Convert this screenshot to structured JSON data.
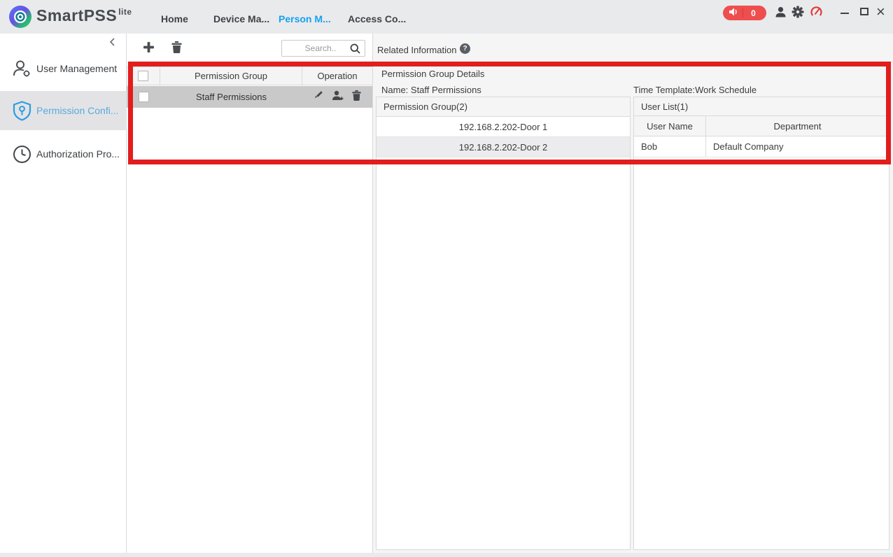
{
  "app": {
    "brand": "SmartPSS",
    "brand_suffix": "lite"
  },
  "nav": {
    "tabs": [
      "Home",
      "Device Ma...",
      "Person M...",
      "Access Co..."
    ],
    "active_tab": "Person M..."
  },
  "topbar": {
    "alarm_count": "0"
  },
  "sidebar": {
    "items": [
      {
        "label": "User Management",
        "icon": "user-gear-icon",
        "active": false
      },
      {
        "label": "Permission Confi...",
        "icon": "shield-key-icon",
        "active": true
      },
      {
        "label": "Authorization Pro...",
        "icon": "clock-icon",
        "active": false
      }
    ]
  },
  "toolbar": {
    "search_placeholder": "Search.."
  },
  "group_table": {
    "columns": [
      "Permission Group",
      "Operation"
    ],
    "rows": [
      {
        "name": "Staff Permissions",
        "selected": true
      }
    ]
  },
  "related": {
    "title": "Related Information",
    "help_glyph": "?",
    "details_title": "Permission Group Details",
    "name_line": "Name: Staff Permissions",
    "time_template_line": "Time Template:Work Schedule",
    "group_list": {
      "header": "Permission Group(2)",
      "items": [
        "192.168.2.202-Door 1",
        "192.168.2.202-Door 2"
      ]
    },
    "user_list": {
      "header": "User List(1)",
      "columns": [
        "User Name",
        "Department"
      ],
      "rows": [
        {
          "name": "Bob",
          "department": "Default Company"
        }
      ]
    }
  },
  "colors": {
    "accent_blue": "#14a2f0",
    "sidebar_active_blue": "#58aadf",
    "alarm_red": "#ef4e4e",
    "annotation_red": "#e11d1d"
  }
}
